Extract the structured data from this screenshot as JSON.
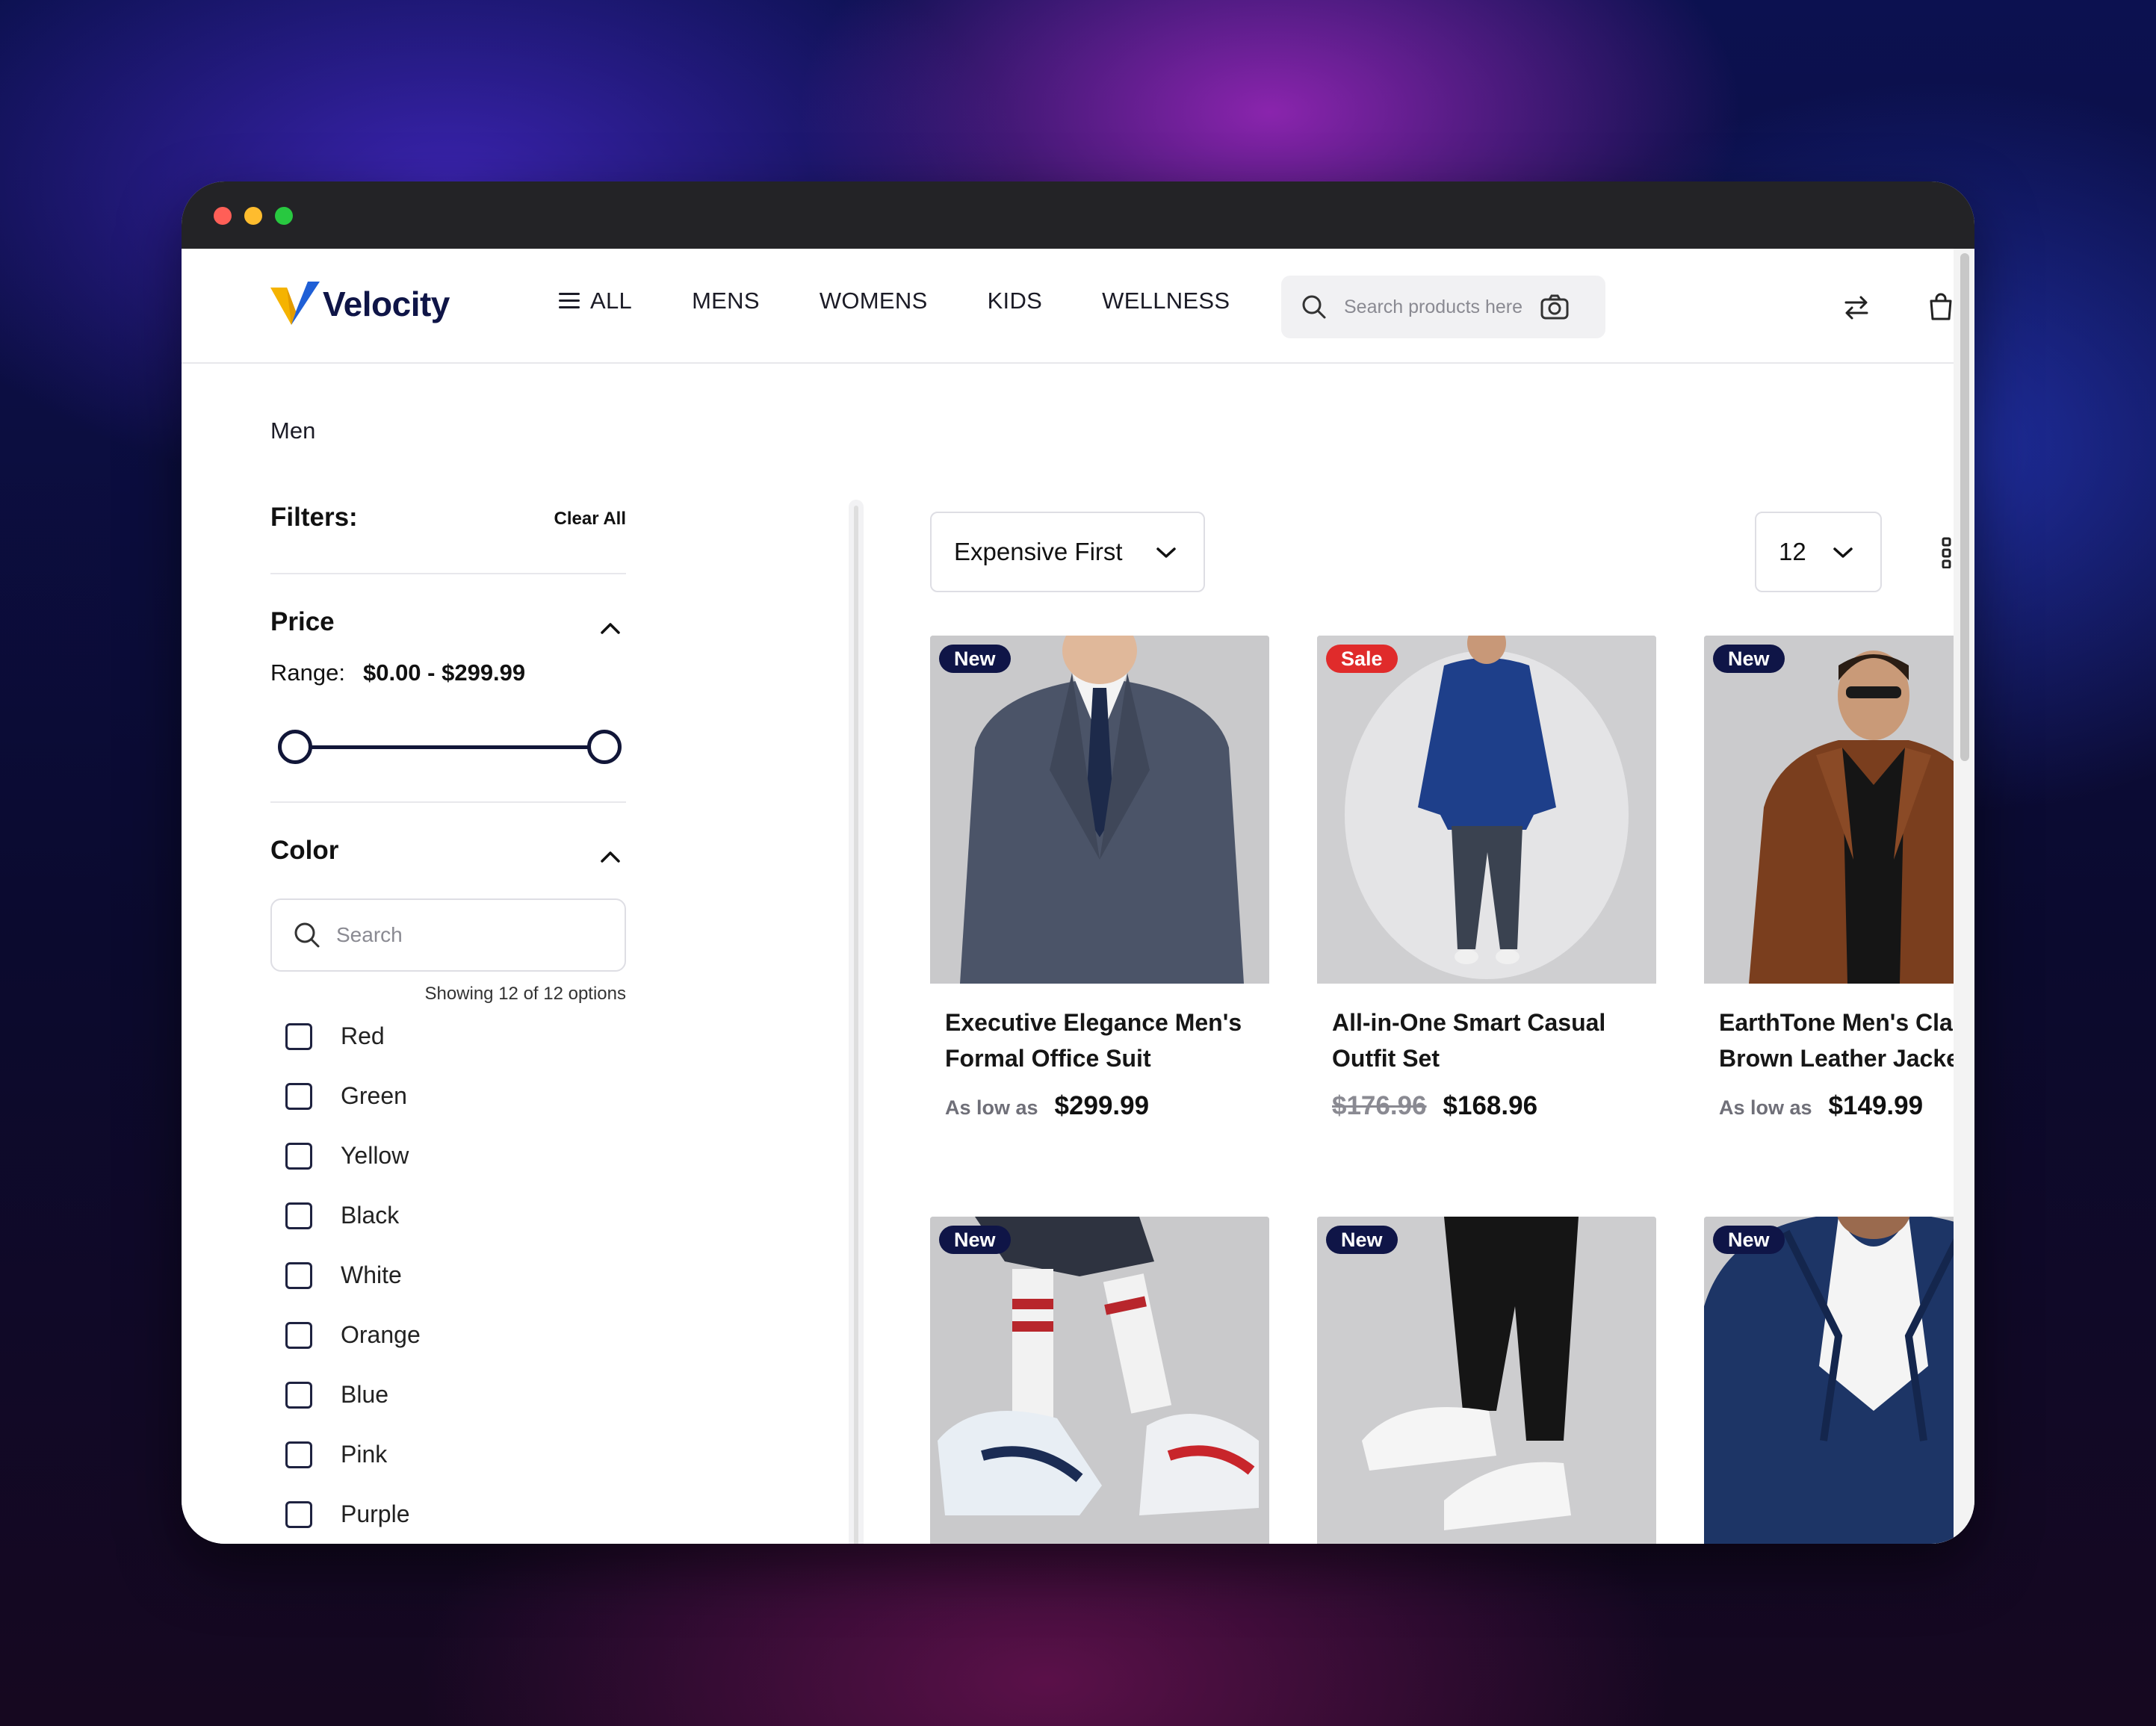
{
  "brand": {
    "name": "Velocity"
  },
  "nav": {
    "all_label": "ALL",
    "items": [
      "MENS",
      "WOMENS",
      "KIDS",
      "WELLNESS"
    ]
  },
  "search": {
    "placeholder": "Search products here"
  },
  "breadcrumb": "Men",
  "filters": {
    "title": "Filters:",
    "clear_all": "Clear All",
    "price": {
      "title": "Price",
      "range_label": "Range:",
      "range_value": "$0.00 - $299.99",
      "min_fraction": 0.0,
      "max_fraction": 1.0
    },
    "color": {
      "title": "Color",
      "search_placeholder": "Search",
      "showing": "Showing 12 of 12 options",
      "options": [
        "Red",
        "Green",
        "Yellow",
        "Black",
        "White",
        "Orange",
        "Blue",
        "Pink",
        "Purple"
      ]
    }
  },
  "toolbar": {
    "sort_value": "Expensive First",
    "per_page": "12"
  },
  "products": [
    {
      "badge": "New",
      "badge_type": "new",
      "name": "Executive Elegance Men's Formal Office Suit",
      "prefix": "As low as",
      "old_price": "",
      "price": "$299.99"
    },
    {
      "badge": "Sale",
      "badge_type": "sale",
      "name": "All-in-One Smart Casual Outfit Set",
      "prefix": "",
      "old_price": "$176.96",
      "price": "$168.96"
    },
    {
      "badge": "New",
      "badge_type": "new",
      "name": "EarthTone Men's Classic Brown Leather Jacket",
      "prefix": "As low as",
      "old_price": "",
      "price": "$149.99"
    },
    {
      "badge": "New",
      "badge_type": "new",
      "name": "",
      "prefix": "",
      "old_price": "",
      "price": ""
    },
    {
      "badge": "New",
      "badge_type": "new",
      "name": "",
      "prefix": "",
      "old_price": "",
      "price": ""
    },
    {
      "badge": "New",
      "badge_type": "new",
      "name": "",
      "prefix": "",
      "old_price": "",
      "price": ""
    }
  ],
  "colors": {
    "primary": "#0f1547",
    "sale": "#e02b2b",
    "accent": "#f5b301"
  }
}
